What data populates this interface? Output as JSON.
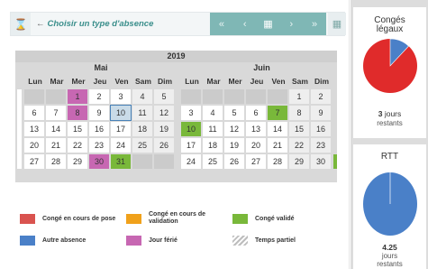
{
  "toolbar": {
    "choose_label": "Choisir un type d'absence",
    "arrow": "←",
    "hourglass": "⌛",
    "nav_first": "«",
    "nav_prev": "‹",
    "nav_calendar": "▦",
    "nav_next": "›",
    "nav_last": "»",
    "calendar_btn": "▦"
  },
  "calendar": {
    "year": "2019",
    "months": [
      "Mai",
      "Juin"
    ],
    "dow": [
      "Lun",
      "Mar",
      "Mer",
      "Jeu",
      "Ven",
      "Sam",
      "Dim",
      "Lun",
      "Mar",
      "Mer",
      "Jeu",
      "Ven",
      "Sam",
      "Dim"
    ]
  },
  "legend": {
    "pose": "Congé en cours de pose",
    "validation": "Congé en cours de validation",
    "valide": "Congé validé",
    "autre": "Autre absence",
    "ferie": "Jour férié",
    "partiel": "Temps partiel"
  },
  "colors": {
    "pose": "#d9534f",
    "validation": "#f0a11b",
    "valide": "#79b83a",
    "autre": "#4a80c8",
    "ferie": "#c767b2",
    "partiel": "#bdbdbd"
  },
  "sidebar": {
    "conges": {
      "title1": "Congés",
      "title2": "légaux",
      "number": "3",
      "unit": "jours",
      "sub": "restants",
      "share_blue": 0.12
    },
    "rtt": {
      "title": "RTT",
      "number": "4.25",
      "unit": "jours",
      "sub": "restants",
      "share_blue": 1.0
    }
  }
}
